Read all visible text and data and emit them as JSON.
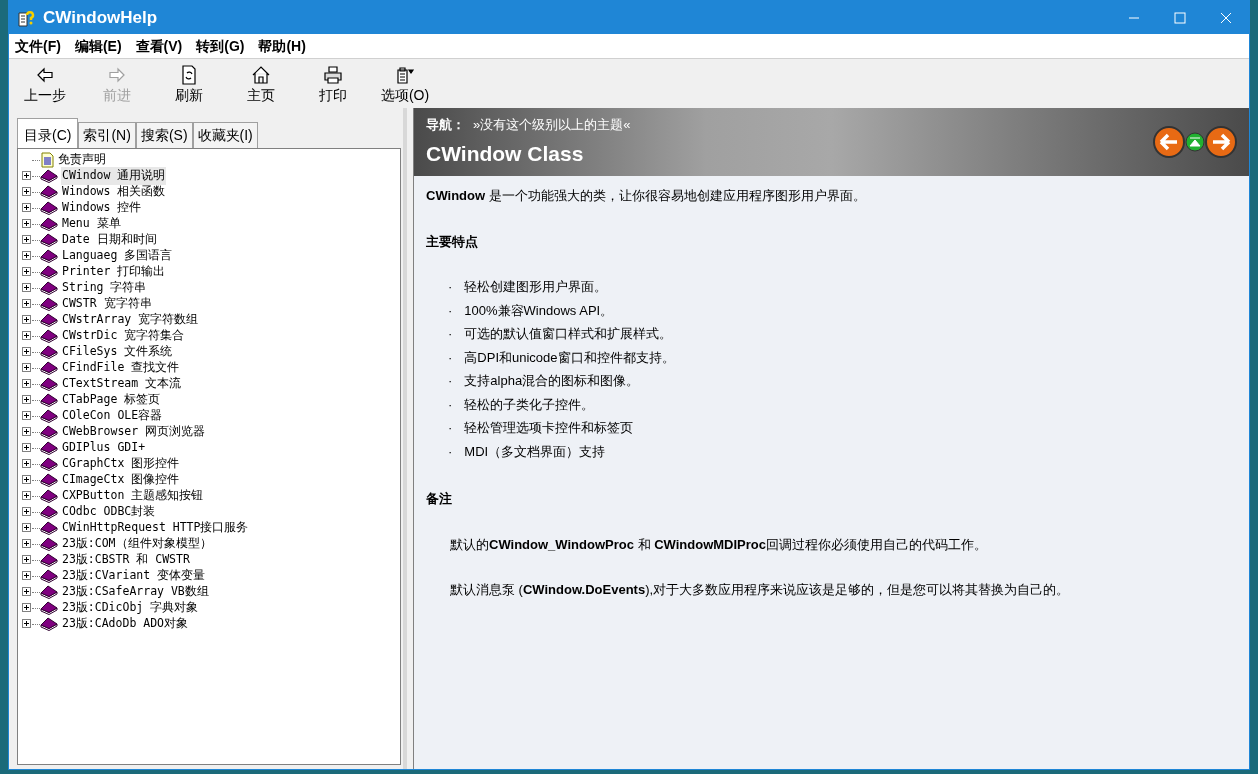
{
  "window": {
    "title": "CWindowHelp"
  },
  "menu": [
    "文件(F)",
    "编辑(E)",
    "查看(V)",
    "转到(G)",
    "帮助(H)"
  ],
  "toolbar": [
    {
      "kind": "back",
      "label": "上一步",
      "disabled": false
    },
    {
      "kind": "forward",
      "label": "前进",
      "disabled": true
    },
    {
      "kind": "refresh",
      "label": "刷新",
      "disabled": false
    },
    {
      "kind": "home",
      "label": "主页",
      "disabled": false
    },
    {
      "kind": "print",
      "label": "打印",
      "disabled": false
    },
    {
      "kind": "options",
      "label": "选项(O)",
      "disabled": false
    }
  ],
  "tabs": [
    {
      "label": "目录(C)",
      "selected": true
    },
    {
      "label": "索引(N)",
      "selected": false
    },
    {
      "label": "搜索(S)",
      "selected": false
    },
    {
      "label": "收藏夹(I)",
      "selected": false
    }
  ],
  "tree": [
    {
      "kind": "page",
      "label": "免责声明",
      "selected": false
    },
    {
      "kind": "book",
      "label": "CWindow 通用说明",
      "selected": true
    },
    {
      "kind": "book",
      "label": "Windows 相关函数",
      "selected": false
    },
    {
      "kind": "book",
      "label": "Windows 控件",
      "selected": false
    },
    {
      "kind": "book",
      "label": "Menu 菜单",
      "selected": false
    },
    {
      "kind": "book",
      "label": "Date 日期和时间",
      "selected": false
    },
    {
      "kind": "book",
      "label": "Languaeg 多国语言",
      "selected": false
    },
    {
      "kind": "book",
      "label": "Printer 打印输出",
      "selected": false
    },
    {
      "kind": "book",
      "label": "String 字符串",
      "selected": false
    },
    {
      "kind": "book",
      "label": "CWSTR 宽字符串",
      "selected": false
    },
    {
      "kind": "book",
      "label": "CWstrArray 宽字符数组",
      "selected": false
    },
    {
      "kind": "book",
      "label": "CWstrDic 宽字符集合",
      "selected": false
    },
    {
      "kind": "book",
      "label": "CFileSys 文件系统",
      "selected": false
    },
    {
      "kind": "book",
      "label": "CFindFile 查找文件",
      "selected": false
    },
    {
      "kind": "book",
      "label": "CTextStream 文本流",
      "selected": false
    },
    {
      "kind": "book",
      "label": "CTabPage 标签页",
      "selected": false
    },
    {
      "kind": "book",
      "label": "COleCon OLE容器",
      "selected": false
    },
    {
      "kind": "book",
      "label": "CWebBrowser 网页浏览器",
      "selected": false
    },
    {
      "kind": "book",
      "label": "GDIPlus GDI+",
      "selected": false
    },
    {
      "kind": "book",
      "label": "CGraphCtx 图形控件",
      "selected": false
    },
    {
      "kind": "book",
      "label": "CImageCtx 图像控件",
      "selected": false
    },
    {
      "kind": "book",
      "label": "CXPButton 主题感知按钮",
      "selected": false
    },
    {
      "kind": "book",
      "label": "COdbc ODBC封装",
      "selected": false
    },
    {
      "kind": "book",
      "label": "CWinHttpRequest HTTP接口服务",
      "selected": false
    },
    {
      "kind": "book",
      "label": "23版:COM（组件对象模型）",
      "selected": false
    },
    {
      "kind": "book",
      "label": "23版:CBSTR 和 CWSTR",
      "selected": false
    },
    {
      "kind": "book",
      "label": "23版:CVariant 变体变量",
      "selected": false
    },
    {
      "kind": "book",
      "label": "23版:CSafeArray VB数组",
      "selected": false
    },
    {
      "kind": "book",
      "label": "23版:CDicObj 字典对象",
      "selected": false
    },
    {
      "kind": "book",
      "label": "23版:CAdoDb ADO对象",
      "selected": false
    }
  ],
  "header": {
    "nav_label": "导航：",
    "nav_text": "»没有这个级别以上的主题«",
    "title": "CWindow Class"
  },
  "content": {
    "intro": "**CWindow** 是一个功能强大的类，让你很容易地创建应用程序图形用户界面。",
    "features_heading": "主要特点",
    "features": [
      "轻松创建图形用户界面。",
      "100%兼容Windows API。",
      "可选的默认值窗口样式和扩展样式。",
      "高DPI和unicode窗口和控件都支持。",
      "支持alpha混合的图标和图像。",
      "轻松的子类化子控件。",
      "轻松管理选项卡控件和标签页",
      "MDI（多文档界面）支持"
    ],
    "bullet": "·",
    "remarks_heading": "备注",
    "remarks": [
      "默认的**CWindow_WindowProc** 和 **CWindowMDIProc**回调过程你必须使用自己的代码工作。",
      "默认消息泵 (**CWindow.DoEvents**),对于大多数应用程序来说应该是足够的，但是您可以将其替换为自己的。"
    ]
  }
}
